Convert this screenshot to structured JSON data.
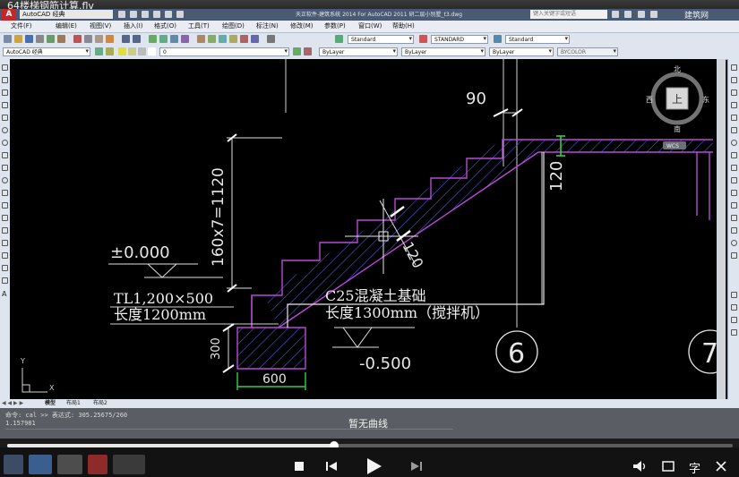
{
  "video": {
    "title": "64楼梯钢筋计算.flv"
  },
  "cad_window": {
    "workspace": "AutoCAD 经典",
    "title": "天正软件-建筑系统 2014  For AutoCAD 2011     研二层小别墅_t3.dwg",
    "search_placeholder": "键入关键字或短语",
    "login_label": "建筑网"
  },
  "menu": [
    "文件(F)",
    "编辑(E)",
    "视图(V)",
    "插入(I)",
    "格式(O)",
    "工具(T)",
    "绘图(D)",
    "标注(N)",
    "修改(M)",
    "参数(P)",
    "窗口(W)",
    "帮助(H)"
  ],
  "toolbar2": {
    "text_style": "Standard",
    "dim_style": "STANDARD",
    "table_style": "Standard"
  },
  "toolbar3": {
    "workspace": "AutoCAD 经典",
    "layer": "0",
    "color": "ByLayer",
    "linetype": "ByLayer",
    "lineweight": "ByLayer",
    "plot_style": "BYCOLOR"
  },
  "viewcube": {
    "top_label": "上",
    "north": "北",
    "south": "南",
    "east": "东",
    "west": "西",
    "wcs": "WCS"
  },
  "drawing": {
    "dim_90": "90",
    "dim_1120": "160x7=1120",
    "dim_120_right": "120",
    "dim_120_slope": "120",
    "level_0": "±0.000",
    "tl_label": "TL1,200×500",
    "tl_length": "长度1200mm",
    "c25_label": "C25混凝土基础",
    "c25_length": "长度1300mm（搅拌机）",
    "dim_300": "300",
    "dim_600": "600",
    "level_neg": "-0.500",
    "axis_6": "6",
    "axis_7": "7",
    "ucs_y": "Y",
    "ucs_x": "X"
  },
  "layout_tabs": [
    "模型",
    "布局1",
    "布局2"
  ],
  "command_line": {
    "line1": "命令: cal >> 表达式: 305.25675/260",
    "line2": "1.157981",
    "status": "暂无曲线"
  },
  "player": {
    "progress": 0.45,
    "subtitle_label": "字"
  }
}
